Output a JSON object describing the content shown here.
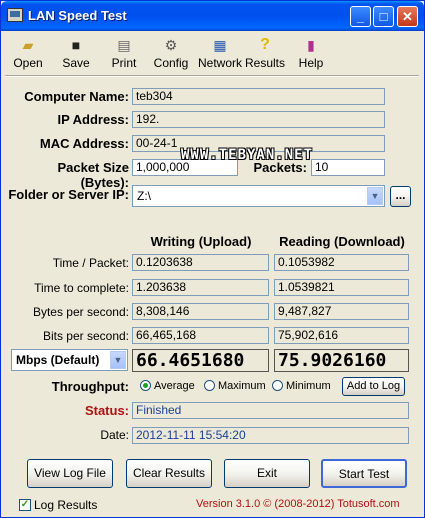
{
  "window": {
    "title": "LAN Speed Test"
  },
  "toolbar": {
    "items": [
      {
        "label": "Open",
        "icon": "open-folder-icon"
      },
      {
        "label": "Save",
        "icon": "floppy-disk-icon"
      },
      {
        "label": "Print",
        "icon": "printer-icon"
      },
      {
        "label": "Config",
        "icon": "config-icon"
      },
      {
        "label": "Network",
        "icon": "network-icon"
      },
      {
        "label": "Results",
        "icon": "question-icon"
      },
      {
        "label": "Help",
        "icon": "help-book-icon"
      }
    ]
  },
  "info": {
    "computer_name_label": "Computer Name:",
    "computer_name": "teb304",
    "ip_label": "IP Address:",
    "ip": "192.",
    "mac_label": "MAC Address:",
    "mac": "00-24-1",
    "packet_size_label": "Packet Size (Bytes):",
    "packet_size": "1,000,000",
    "packets_label": "Packets:",
    "packets": "10",
    "folder_label": "Folder or Server IP:",
    "folder": "Z:\\",
    "browse_label": "..."
  },
  "watermark": "WWW.TEBYAN.NET",
  "results": {
    "writing_header": "Writing (Upload)",
    "reading_header": "Reading (Download)",
    "rows": [
      {
        "label": "Time / Packet:",
        "write": "0.1203638",
        "read": "0.1053982"
      },
      {
        "label": "Time to complete:",
        "write": "1.203638",
        "read": "1.0539821"
      },
      {
        "label": "Bytes per second:",
        "write": "8,308,146",
        "read": "9,487,827"
      },
      {
        "label": "Bits per second:",
        "write": "66,465,168",
        "read": "75,902,616"
      }
    ],
    "unit_select": "Mbps (Default)",
    "write_big": "66.4651680",
    "read_big": "75.9026160"
  },
  "throughput": {
    "label": "Throughput:",
    "options": [
      "Average",
      "Maximum",
      "Minimum"
    ],
    "selected": "Average",
    "add_to_log": "Add to Log"
  },
  "status": {
    "label": "Status:",
    "value": "Finished",
    "label_color": "#b01010"
  },
  "date": {
    "label": "Date:",
    "value": "2012-11-11 15:54:20"
  },
  "buttons": {
    "view_log": "View Log File",
    "clear": "Clear Results",
    "exit": "Exit",
    "start": "Start Test"
  },
  "footer": {
    "log_results": "Log Results",
    "log_checked": true,
    "version": "Version 3.1.0  © (2008-2012) Totusoft.com",
    "version_color": "#b01010"
  }
}
